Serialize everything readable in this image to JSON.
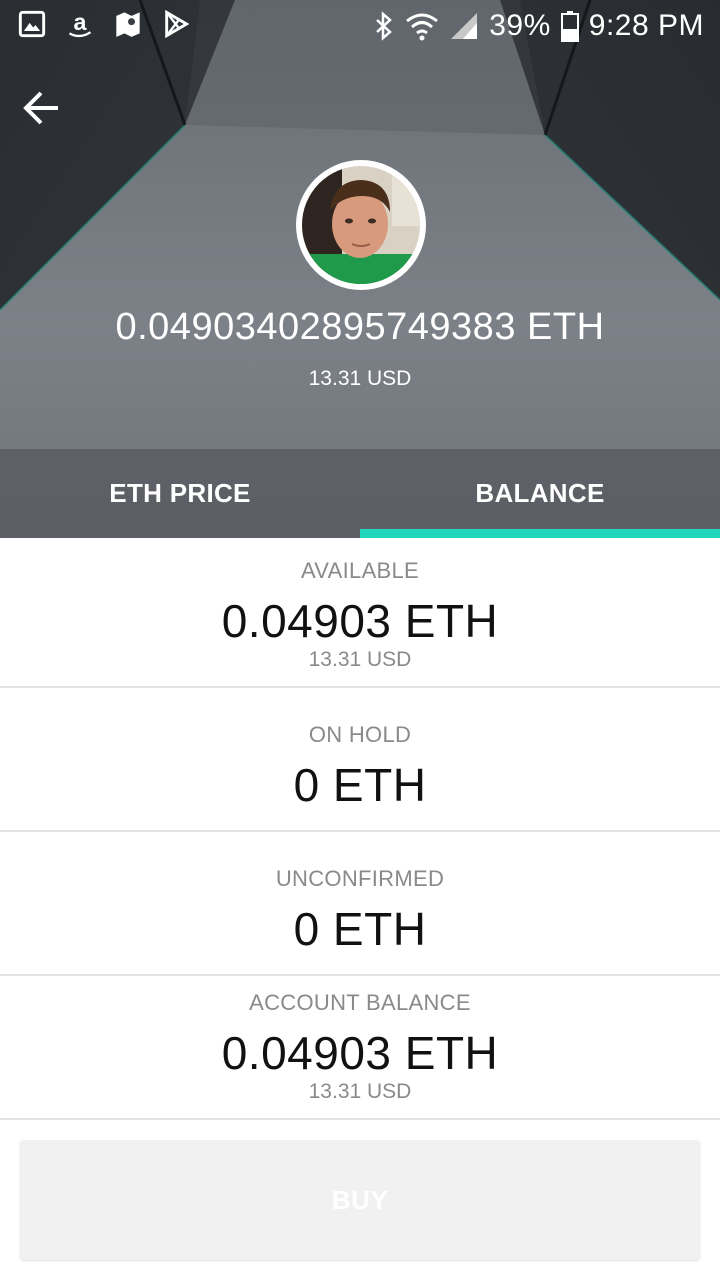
{
  "status_bar": {
    "battery": "39%",
    "time": "9:28 PM",
    "left_icons": [
      "gallery-icon",
      "amazon-icon",
      "maps-icon",
      "play-store-icon"
    ],
    "right_icons": [
      "bluetooth-icon",
      "wifi-icon",
      "signal-icon",
      "battery-icon"
    ]
  },
  "header": {
    "balance_eth": "0.04903402895749383 ETH",
    "balance_usd": "13.31 USD"
  },
  "tabs": [
    {
      "label": "ETH PRICE",
      "active": false
    },
    {
      "label": "BALANCE",
      "active": true
    }
  ],
  "sections": {
    "available": {
      "label": "AVAILABLE",
      "value": "0.04903 ETH",
      "usd": "13.31 USD"
    },
    "on_hold": {
      "label": "ON HOLD",
      "value": "0 ETH"
    },
    "unconfirmed": {
      "label": "UNCONFIRMED",
      "value": "0 ETH"
    },
    "account_balance": {
      "label": "ACCOUNT BALANCE",
      "value": "0.04903 ETH",
      "usd": "13.31 USD"
    }
  },
  "actions": {
    "buy_label": "BUY",
    "buy_enabled": false
  },
  "colors": {
    "accent": "#1fd6bd",
    "hero_background": "#3c4046",
    "tab_bar": "#55585d",
    "muted_text": "#8a8a8a"
  }
}
